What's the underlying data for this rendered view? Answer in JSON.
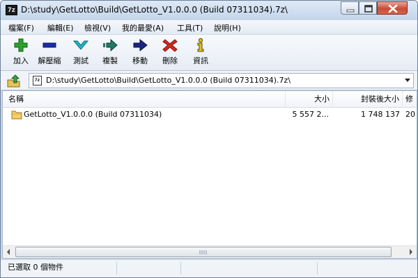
{
  "window": {
    "app_icon": "7z",
    "title": "D:\\study\\GetLotto\\Build\\GetLotto_V1.0.0.0 (Build 07311034).7z\\",
    "controls": [
      "minimize-icon",
      "maximize-icon",
      "close-icon"
    ]
  },
  "menu": {
    "items": [
      {
        "label": "檔案(F)"
      },
      {
        "label": "編輯(E)"
      },
      {
        "label": "檢視(V)"
      },
      {
        "label": "我的最愛(A)"
      },
      {
        "label": "工具(T)"
      },
      {
        "label": "說明(H)"
      }
    ]
  },
  "toolbar": {
    "buttons": [
      {
        "label": "加入",
        "icon": "add-plus-icon",
        "color": "#2ca02c"
      },
      {
        "label": "解壓縮",
        "icon": "extract-minus-icon",
        "color": "#1a2ea8"
      },
      {
        "label": "測試",
        "icon": "test-check-icon",
        "color": "#1fb7c9"
      },
      {
        "label": "複製",
        "icon": "copy-arrow-icon",
        "color": "#1f7a66"
      },
      {
        "label": "移動",
        "icon": "move-arrow-icon",
        "color": "#1a2580"
      },
      {
        "label": "刪除",
        "icon": "delete-x-icon",
        "color": "#d42a1e"
      },
      {
        "label": "資訊",
        "icon": "info-icon",
        "color": "#e0c020"
      }
    ]
  },
  "address": {
    "up_icon": "folder-up-icon",
    "path": "D:\\study\\GetLotto\\Build\\GetLotto_V1.0.0.0 (Build 07311034).7z\\"
  },
  "list": {
    "columns": {
      "name": "名稱",
      "size": "大小",
      "packed": "封裝後大小",
      "modified": "修"
    },
    "rows": [
      {
        "icon": "folder-icon",
        "name": "GetLotto_V1.0.0.0 (Build 07311034)",
        "size": "5 557 2...",
        "packed": "1 748 137",
        "modified": "20"
      }
    ]
  },
  "status": {
    "selection": "已選取 0 個物件"
  }
}
